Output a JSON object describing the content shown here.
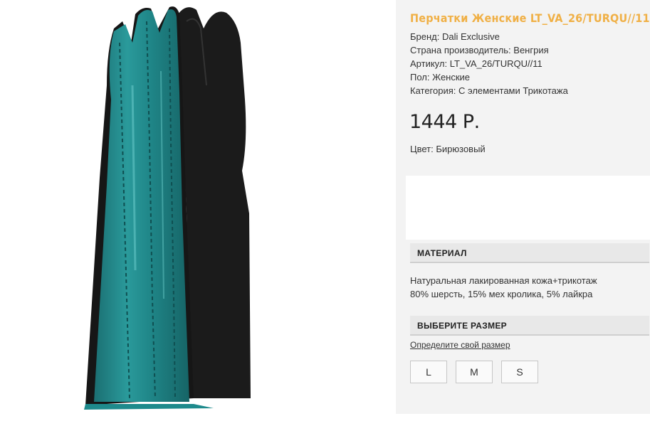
{
  "product": {
    "title": "Перчатки Женские LT_VA_26/TURQU//11",
    "specs": [
      "Бренд: Dali Exclusive",
      "Страна производитель: Венгрия",
      "Артикул: LT_VA_26/TURQU//11",
      "Пол: Женские",
      "Категория: С элементами Трикотажа"
    ],
    "price": "1444 Р.",
    "color": "Цвет: Бирюзовый"
  },
  "material": {
    "heading": "МАТЕРИАЛ",
    "lines": [
      "Натуральная лакированная кожа+трикотаж",
      "80% шерсть, 15% мех кролика, 5% лайкра"
    ]
  },
  "size": {
    "heading": "ВЫБЕРИТЕ РАЗМЕР",
    "link": "Определите свой размер",
    "options": [
      "L",
      "M",
      "S"
    ]
  },
  "colors": {
    "title": "#f0b046",
    "glove_teal": "#1e8a8c",
    "glove_black": "#1a1a1a",
    "panel": "#f3f3f3"
  }
}
